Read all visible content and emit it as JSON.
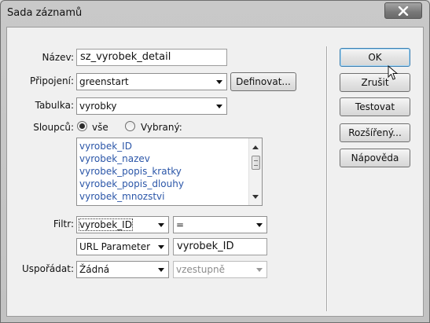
{
  "window": {
    "title": "Sada záznamů"
  },
  "form": {
    "name_label": "Název:",
    "name_value": "sz_vyrobek_detail",
    "connection_label": "Připojení:",
    "connection_value": "greenstart",
    "define_button": "Definovat...",
    "table_label": "Tabulka:",
    "table_value": "vyrobky",
    "columns_label": "Sloupců:",
    "columns_all": "vše",
    "columns_selected": "Vybraný:",
    "columns_list": [
      "vyrobek_ID",
      "vyrobek_nazev",
      "vyrobek_popis_kratky",
      "vyrobek_popis_dlouhy",
      "vyrobek_mnozstvi"
    ],
    "filter_label": "Filtr:",
    "filter_column": "vyrobek_ID",
    "filter_operator": "=",
    "filter_source": "URL Parameter",
    "filter_value": "vyrobek_ID",
    "sort_label": "Uspořádat:",
    "sort_column": "Žádná",
    "sort_direction": "vzestupně"
  },
  "buttons": {
    "ok": "OK",
    "cancel": "Zrušit",
    "test": "Testovat",
    "advanced": "Rozšířený...",
    "help": "Nápověda"
  }
}
